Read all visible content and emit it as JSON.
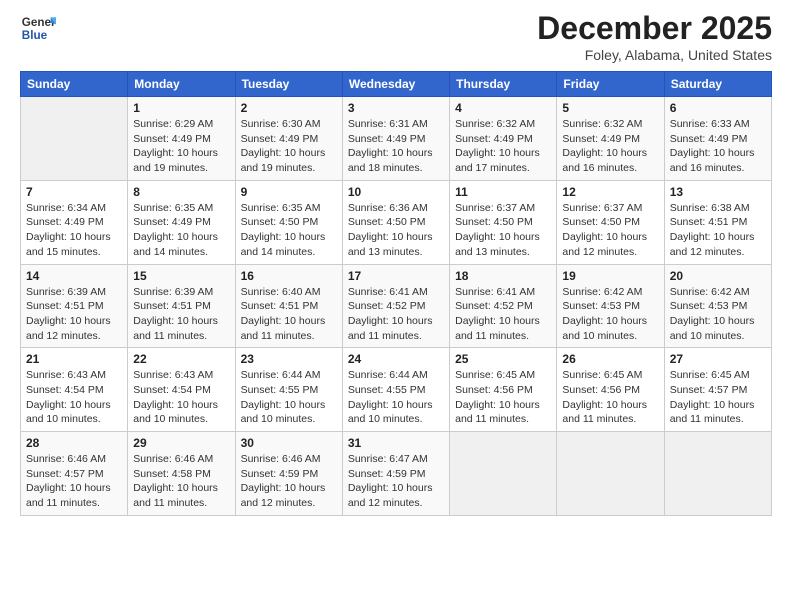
{
  "header": {
    "title": "December 2025",
    "subtitle": "Foley, Alabama, United States"
  },
  "calendar": {
    "columns": [
      "Sunday",
      "Monday",
      "Tuesday",
      "Wednesday",
      "Thursday",
      "Friday",
      "Saturday"
    ]
  },
  "weeks": [
    [
      {
        "day": "",
        "info": ""
      },
      {
        "day": "1",
        "info": "Sunrise: 6:29 AM\nSunset: 4:49 PM\nDaylight: 10 hours\nand 19 minutes."
      },
      {
        "day": "2",
        "info": "Sunrise: 6:30 AM\nSunset: 4:49 PM\nDaylight: 10 hours\nand 19 minutes."
      },
      {
        "day": "3",
        "info": "Sunrise: 6:31 AM\nSunset: 4:49 PM\nDaylight: 10 hours\nand 18 minutes."
      },
      {
        "day": "4",
        "info": "Sunrise: 6:32 AM\nSunset: 4:49 PM\nDaylight: 10 hours\nand 17 minutes."
      },
      {
        "day": "5",
        "info": "Sunrise: 6:32 AM\nSunset: 4:49 PM\nDaylight: 10 hours\nand 16 minutes."
      },
      {
        "day": "6",
        "info": "Sunrise: 6:33 AM\nSunset: 4:49 PM\nDaylight: 10 hours\nand 16 minutes."
      }
    ],
    [
      {
        "day": "7",
        "info": "Sunrise: 6:34 AM\nSunset: 4:49 PM\nDaylight: 10 hours\nand 15 minutes."
      },
      {
        "day": "8",
        "info": "Sunrise: 6:35 AM\nSunset: 4:49 PM\nDaylight: 10 hours\nand 14 minutes."
      },
      {
        "day": "9",
        "info": "Sunrise: 6:35 AM\nSunset: 4:50 PM\nDaylight: 10 hours\nand 14 minutes."
      },
      {
        "day": "10",
        "info": "Sunrise: 6:36 AM\nSunset: 4:50 PM\nDaylight: 10 hours\nand 13 minutes."
      },
      {
        "day": "11",
        "info": "Sunrise: 6:37 AM\nSunset: 4:50 PM\nDaylight: 10 hours\nand 13 minutes."
      },
      {
        "day": "12",
        "info": "Sunrise: 6:37 AM\nSunset: 4:50 PM\nDaylight: 10 hours\nand 12 minutes."
      },
      {
        "day": "13",
        "info": "Sunrise: 6:38 AM\nSunset: 4:51 PM\nDaylight: 10 hours\nand 12 minutes."
      }
    ],
    [
      {
        "day": "14",
        "info": "Sunrise: 6:39 AM\nSunset: 4:51 PM\nDaylight: 10 hours\nand 12 minutes."
      },
      {
        "day": "15",
        "info": "Sunrise: 6:39 AM\nSunset: 4:51 PM\nDaylight: 10 hours\nand 11 minutes."
      },
      {
        "day": "16",
        "info": "Sunrise: 6:40 AM\nSunset: 4:51 PM\nDaylight: 10 hours\nand 11 minutes."
      },
      {
        "day": "17",
        "info": "Sunrise: 6:41 AM\nSunset: 4:52 PM\nDaylight: 10 hours\nand 11 minutes."
      },
      {
        "day": "18",
        "info": "Sunrise: 6:41 AM\nSunset: 4:52 PM\nDaylight: 10 hours\nand 11 minutes."
      },
      {
        "day": "19",
        "info": "Sunrise: 6:42 AM\nSunset: 4:53 PM\nDaylight: 10 hours\nand 10 minutes."
      },
      {
        "day": "20",
        "info": "Sunrise: 6:42 AM\nSunset: 4:53 PM\nDaylight: 10 hours\nand 10 minutes."
      }
    ],
    [
      {
        "day": "21",
        "info": "Sunrise: 6:43 AM\nSunset: 4:54 PM\nDaylight: 10 hours\nand 10 minutes."
      },
      {
        "day": "22",
        "info": "Sunrise: 6:43 AM\nSunset: 4:54 PM\nDaylight: 10 hours\nand 10 minutes."
      },
      {
        "day": "23",
        "info": "Sunrise: 6:44 AM\nSunset: 4:55 PM\nDaylight: 10 hours\nand 10 minutes."
      },
      {
        "day": "24",
        "info": "Sunrise: 6:44 AM\nSunset: 4:55 PM\nDaylight: 10 hours\nand 10 minutes."
      },
      {
        "day": "25",
        "info": "Sunrise: 6:45 AM\nSunset: 4:56 PM\nDaylight: 10 hours\nand 11 minutes."
      },
      {
        "day": "26",
        "info": "Sunrise: 6:45 AM\nSunset: 4:56 PM\nDaylight: 10 hours\nand 11 minutes."
      },
      {
        "day": "27",
        "info": "Sunrise: 6:45 AM\nSunset: 4:57 PM\nDaylight: 10 hours\nand 11 minutes."
      }
    ],
    [
      {
        "day": "28",
        "info": "Sunrise: 6:46 AM\nSunset: 4:57 PM\nDaylight: 10 hours\nand 11 minutes."
      },
      {
        "day": "29",
        "info": "Sunrise: 6:46 AM\nSunset: 4:58 PM\nDaylight: 10 hours\nand 11 minutes."
      },
      {
        "day": "30",
        "info": "Sunrise: 6:46 AM\nSunset: 4:59 PM\nDaylight: 10 hours\nand 12 minutes."
      },
      {
        "day": "31",
        "info": "Sunrise: 6:47 AM\nSunset: 4:59 PM\nDaylight: 10 hours\nand 12 minutes."
      },
      {
        "day": "",
        "info": ""
      },
      {
        "day": "",
        "info": ""
      },
      {
        "day": "",
        "info": ""
      }
    ]
  ]
}
